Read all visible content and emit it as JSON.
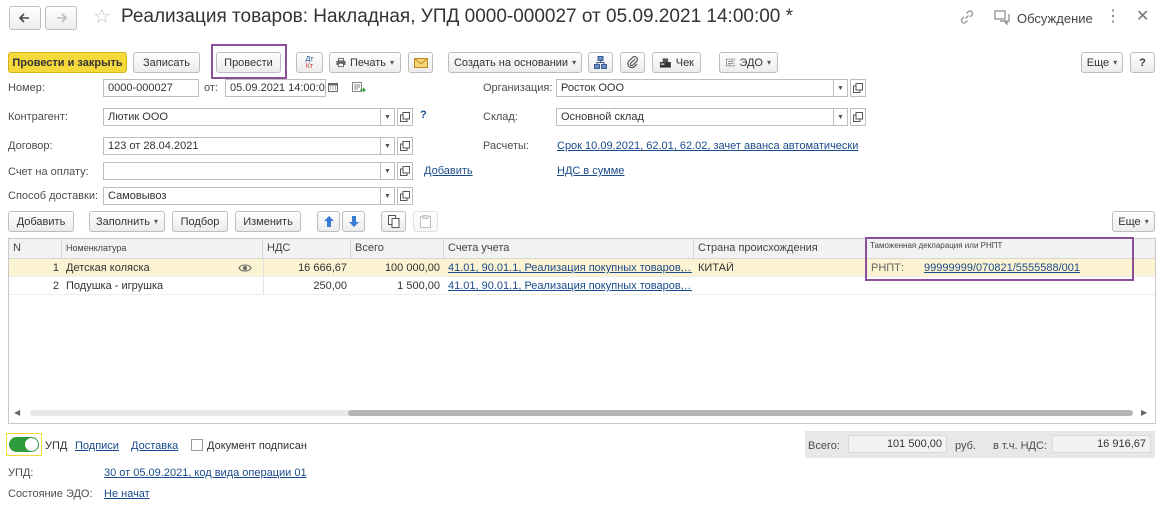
{
  "window": {
    "title": "Реализация товаров: Накладная, УПД 0000-000027 от 05.09.2021 14:00:00 *",
    "discuss_label": "Обсуждение"
  },
  "toolbar": {
    "post_close": "Провести и закрыть",
    "save": "Записать",
    "post": "Провести",
    "dtkt": "Дт\nКт",
    "print": "Печать",
    "create_based": "Создать на основании",
    "check": "Чек",
    "edo": "ЭДО",
    "more": "Еще",
    "help": "?"
  },
  "form": {
    "number_label": "Номер:",
    "number_value": "0000-000027",
    "from_label": "от:",
    "date_value": "05.09.2021 14:00:0",
    "counterparty_label": "Контрагент:",
    "counterparty_value": "Лютик ООО",
    "contract_label": "Договор:",
    "contract_value": "123 от 28.04.2021",
    "invoice_label": "Счет на оплату:",
    "invoice_value": "",
    "add_link": "Добавить",
    "delivery_label": "Способ доставки:",
    "delivery_value": "Самовывоз",
    "org_label": "Организация:",
    "org_value": "Росток ООО",
    "warehouse_label": "Склад:",
    "warehouse_value": "Основной склад",
    "settlements_label": "Расчеты:",
    "settlements_link": "Срок 10.09.2021, 62.01, 62.02, зачет аванса автоматически",
    "vat_link": "НДС в сумме"
  },
  "table_toolbar": {
    "add": "Добавить",
    "fill": "Заполнить",
    "pick": "Подбор",
    "change": "Изменить",
    "more": "Еще"
  },
  "table": {
    "headers": {
      "n": "N",
      "item": "Номенклатура",
      "vat": "НДС",
      "total": "Всего",
      "account": "Счета учета",
      "country": "Страна происхождения",
      "customs": "Таможенная декларация или РНПТ"
    },
    "rows": [
      {
        "n": "1",
        "item": "Детская коляска",
        "vat": "16 666,67",
        "total": "100 000,00",
        "account": "41.01, 90.01.1, Реализация покупных товаров,…",
        "country": "КИТАЙ",
        "rnpt_label": "РНПТ:",
        "rnpt_value": "99999999/070821/5555588/001"
      },
      {
        "n": "2",
        "item": "Подушка - игрушка",
        "vat": "250,00",
        "total": "1 500,00",
        "account": "41.01, 90.01.1, Реализация покупных товаров,…",
        "country": "",
        "rnpt_label": "",
        "rnpt_value": ""
      }
    ]
  },
  "footer": {
    "upd_toggle": "УПД",
    "signers": "Подписи",
    "delivery": "Доставка",
    "signed_label": "Документ подписан",
    "total_label": "Всего:",
    "total_value": "101 500,00",
    "currency": "руб.",
    "vat_incl_label": "в т.ч. НДС:",
    "vat_value": "16 916,67",
    "upd_label": "УПД:",
    "upd_link": "30 от 05.09.2021, код вида операции 01",
    "edo_label": "Состояние ЭДО:",
    "edo_link": "Не начат"
  },
  "colors": {
    "primary_button": "#f5d93a",
    "highlight_frame": "#8e4f9a",
    "link": "#1a4b8c",
    "selected_row": "#fbf3d2",
    "toggle_on": "#2e9b3c"
  }
}
